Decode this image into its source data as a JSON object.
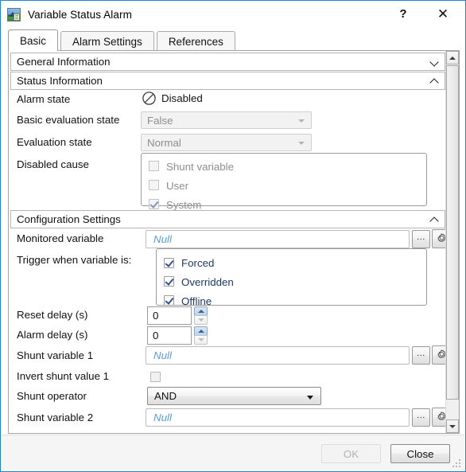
{
  "window": {
    "title": "Variable Status Alarm",
    "icon": "variable-image-icon",
    "help_label": "?",
    "close_label": "✕",
    "accent_color": "#1a84d8"
  },
  "tabs": [
    {
      "label": "Basic",
      "active": true
    },
    {
      "label": "Alarm Settings",
      "active": false
    },
    {
      "label": "References",
      "active": false
    }
  ],
  "groups": {
    "general_information": {
      "label": "General Information",
      "expanded": false,
      "chevron": "chevron-down-icon"
    },
    "status_information": {
      "label": "Status Information",
      "expanded": true,
      "chevron": "chevron-up-icon"
    },
    "configuration_settings": {
      "label": "Configuration Settings",
      "expanded": true,
      "chevron": "chevron-up-icon"
    }
  },
  "status_information": {
    "alarm_state": {
      "label": "Alarm state",
      "value": "Disabled",
      "icon": "prohibited-icon"
    },
    "basic_evaluation_state": {
      "label": "Basic evaluation state",
      "value": "False",
      "disabled": true
    },
    "evaluation_state": {
      "label": "Evaluation state",
      "value": "Normal",
      "disabled": true
    },
    "disabled_cause": {
      "label": "Disabled cause",
      "items": [
        {
          "label": "Shunt variable",
          "checked": false
        },
        {
          "label": "User",
          "checked": false
        },
        {
          "label": "System",
          "checked": true
        }
      ]
    }
  },
  "configuration_settings": {
    "monitored_variable": {
      "label": "Monitored variable",
      "value": "",
      "placeholder": "Null",
      "browse_label": "...",
      "browse_icon": "ellipsis-icon",
      "config_icon": "gear-icon"
    },
    "trigger_when": {
      "label": "Trigger when variable is:",
      "items": [
        {
          "label": "Forced",
          "checked": true
        },
        {
          "label": "Overridden",
          "checked": true
        },
        {
          "label": "Offline",
          "checked": true
        }
      ],
      "label_color": "#1f3864"
    },
    "reset_delay": {
      "label": "Reset delay (s)",
      "value": "0",
      "increment_icon": "spinner-up-icon",
      "decrement_icon": "spinner-down-icon"
    },
    "alarm_delay": {
      "label": "Alarm delay (s)",
      "value": "0",
      "increment_icon": "spinner-up-icon",
      "decrement_icon": "spinner-down-icon"
    },
    "shunt_variable_1": {
      "label": "Shunt variable 1",
      "value": "",
      "placeholder": "Null",
      "browse_label": "...",
      "browse_icon": "ellipsis-icon",
      "config_icon": "gear-icon"
    },
    "invert_shunt_value_1": {
      "label": "Invert shunt value 1",
      "checked": false
    },
    "shunt_operator": {
      "label": "Shunt operator",
      "value": "AND",
      "chevron": "chevron-down-icon"
    },
    "shunt_variable_2": {
      "label": "Shunt variable 2",
      "value": "",
      "placeholder": "Null",
      "browse_label": "...",
      "browse_icon": "ellipsis-icon",
      "config_icon": "gear-icon"
    }
  },
  "scrollbar": {
    "up_icon": "scroll-up-icon",
    "down_icon": "scroll-down-icon",
    "thumb": "scroll-thumb"
  },
  "footer": {
    "ok_label": "OK",
    "ok_enabled": false,
    "close_label": "Close",
    "close_enabled": true,
    "resize_grip": "resize-grip-icon"
  }
}
